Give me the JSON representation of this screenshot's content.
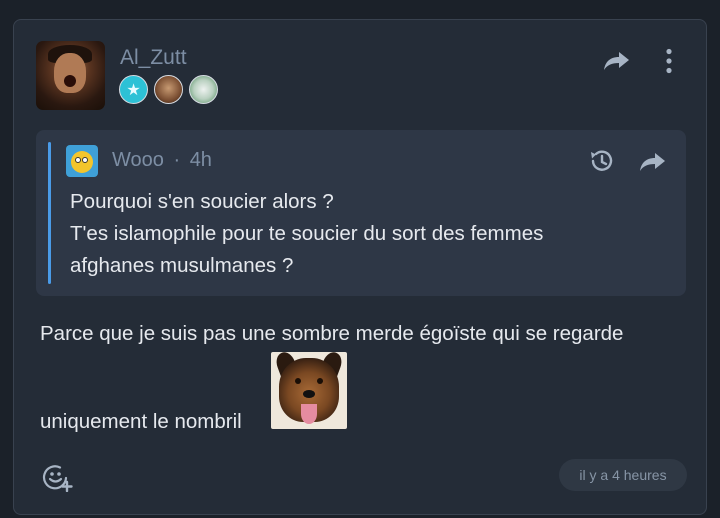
{
  "post": {
    "author": "Al_Zutt",
    "badges": [
      "star-badge",
      "portrait-badge",
      "dog-badge"
    ],
    "quote": {
      "author": "Wooo",
      "separator": "·",
      "time": "4h",
      "lines": [
        "Pourquoi s'en soucier alors ?",
        "T'es islamophile pour te soucier du sort des femmes",
        "afghanes musulmanes ?"
      ]
    },
    "body": {
      "line1": "Parce que je suis pas une sombre merde égoïste qui se regarde",
      "line2": "uniquement le nombril"
    },
    "sticker": "dog-sticker",
    "timestamp": "il y a 4 heures"
  },
  "colors": {
    "background": "#1b2129",
    "card": "#242c37",
    "quote_bg": "#2e3746",
    "quote_bar": "#4a9be8",
    "username": "#7d8ea4",
    "text": "#e6e9ee"
  }
}
